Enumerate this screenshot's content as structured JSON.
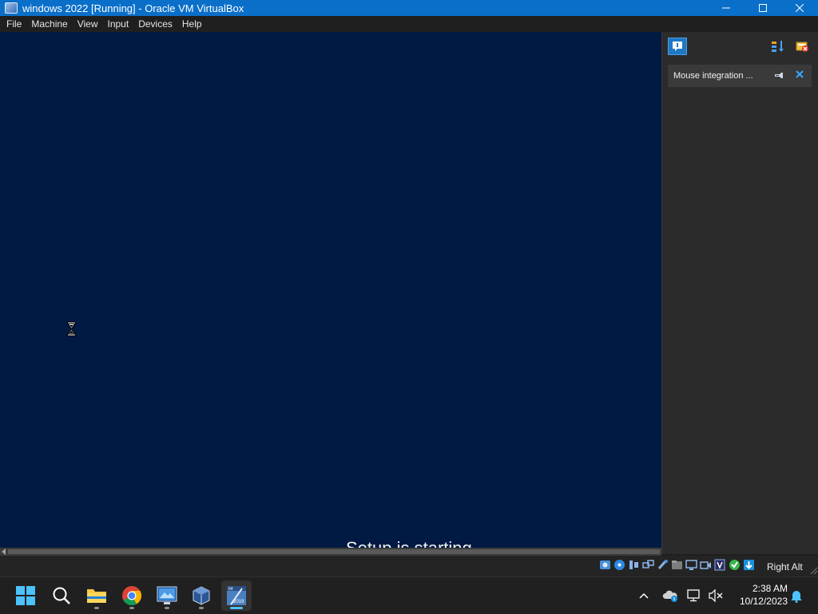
{
  "window": {
    "title": "windows 2022 [Running] - Oracle VM VirtualBox",
    "controls": {
      "minimize": "—",
      "maximize": "☐",
      "close": "✕"
    }
  },
  "menu": [
    "File",
    "Machine",
    "View",
    "Input",
    "Devices",
    "Help"
  ],
  "vm": {
    "status_text": "Setup is starting",
    "background_color": "#011a43",
    "cursor": "hourglass-cursor"
  },
  "notification_panel": {
    "buttons": [
      "notification-center-icon",
      "sort-icon",
      "clear-all-icon"
    ],
    "notifications": [
      {
        "text": "Mouse integration ...",
        "pin_icon": "pin-icon",
        "close_icon": "close-icon"
      }
    ]
  },
  "statusbar": {
    "icons": [
      "hard-disk-icon",
      "optical-drive-icon",
      "audio-icon",
      "network-icon",
      "usb-icon",
      "shared-folders-icon",
      "display-icon",
      "recording-icon",
      "vt-x-icon",
      "guest-additions-icon",
      "mouse-integration-icon"
    ],
    "host_key": "Right Alt"
  },
  "taskbar": {
    "apps": [
      {
        "name": "start-button",
        "icon": "windows-logo-icon"
      },
      {
        "name": "search-button",
        "icon": "search-icon"
      },
      {
        "name": "file-explorer",
        "icon": "folder-icon"
      },
      {
        "name": "chrome",
        "icon": "chrome-icon"
      },
      {
        "name": "remote-desktop",
        "icon": "remote-desktop-icon"
      },
      {
        "name": "virtualbox-manager",
        "icon": "virtualbox-icon"
      },
      {
        "name": "windows-2022-vm",
        "icon": "vm-window-icon"
      }
    ],
    "vm_window_badge_top": "64",
    "vm_window_badge_bottom": "2019",
    "clock": {
      "time": "2:38 AM",
      "date": "10/12/2023"
    },
    "colors": {
      "accent": "#4cc2ff",
      "windows_blue": "#0a6fc9"
    }
  }
}
